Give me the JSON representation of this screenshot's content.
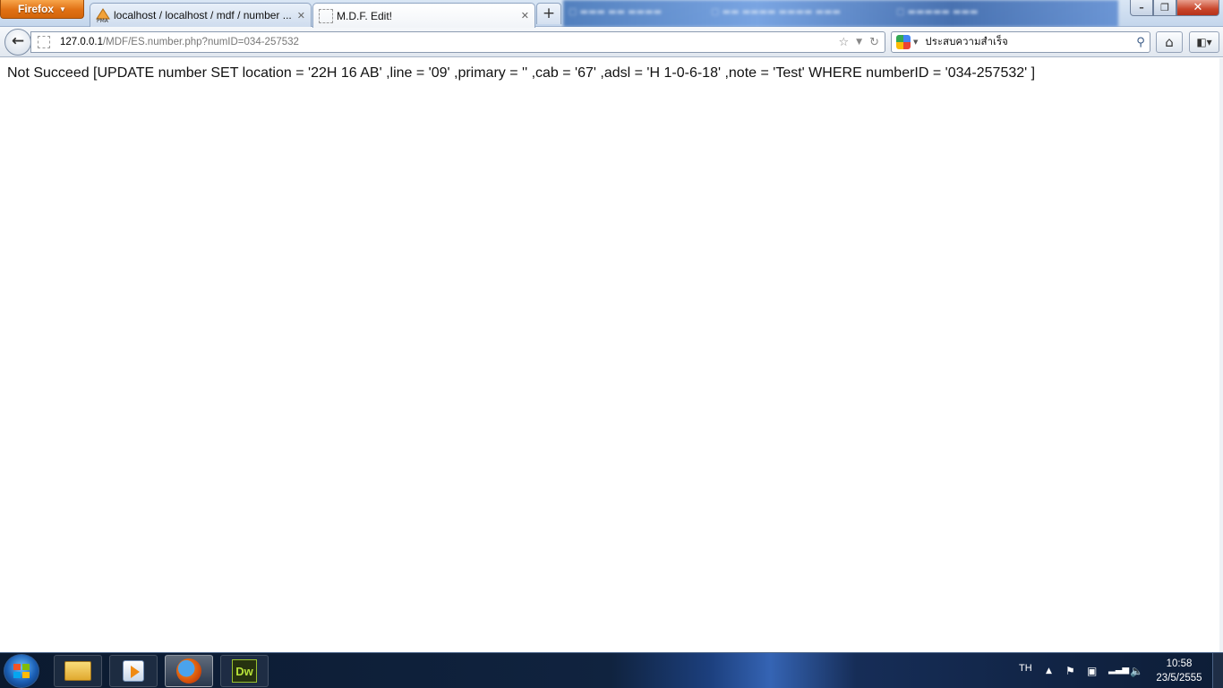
{
  "browser": {
    "menu_button": "Firefox",
    "tabs": [
      {
        "label": "localhost / localhost / mdf / number ..."
      },
      {
        "label": "M.D.F. Edit!"
      }
    ],
    "new_tab": "+",
    "url": {
      "host": "127.0.0.1",
      "path": "/MDF/ES.number.php?numID=034-257532"
    },
    "search": {
      "text": "ประสบความสำเร็จ"
    }
  },
  "page": {
    "message": "Not Succeed [UPDATE number SET location = '22H 16 AB' ,line = '09' ,primary = '' ,cab = '67' ,adsl = 'H 1-0-6-18' ,note = 'Test' WHERE numberID = '034-257532' ]"
  },
  "taskbar": {
    "apps": [
      {
        "name": "Windows Explorer",
        "icon": "folder-icon"
      },
      {
        "name": "Media Player",
        "icon": "media-player-icon"
      },
      {
        "name": "Firefox",
        "icon": "firefox-icon"
      },
      {
        "name": "Dreamweaver",
        "icon": "dreamweaver-icon",
        "label": "Dw"
      }
    ],
    "language": "TH",
    "time": "10:58",
    "date": "23/5/2555"
  }
}
